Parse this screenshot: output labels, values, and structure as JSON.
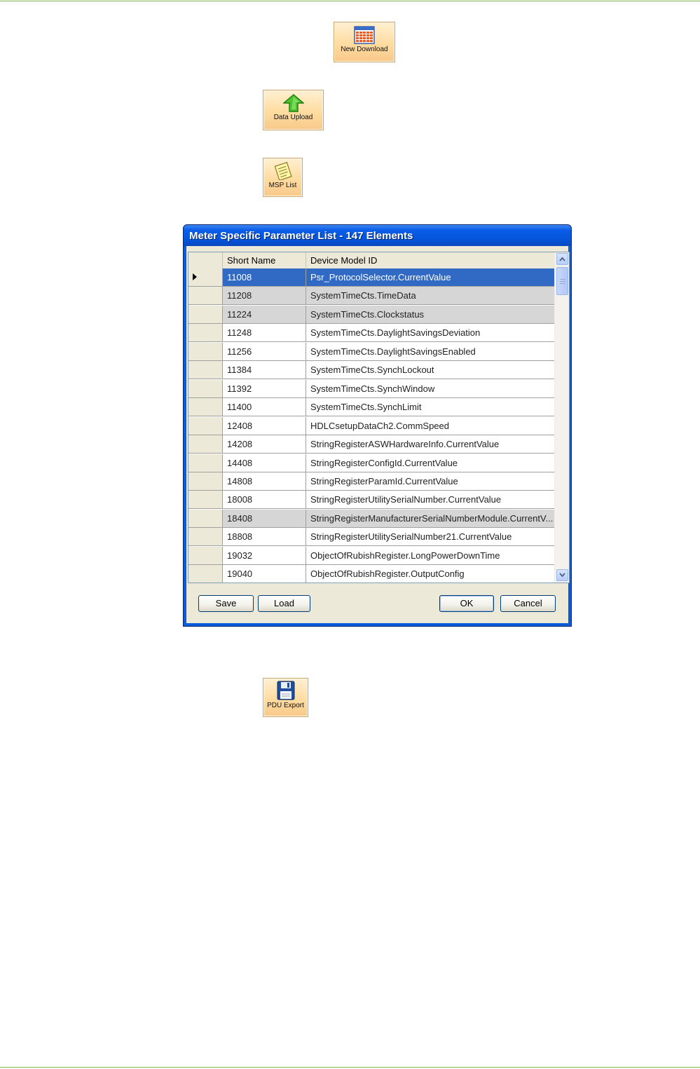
{
  "toolbar": {
    "new_download": "New Download",
    "data_upload": "Data Upload",
    "msp_list": "MSP List",
    "pdu_export": "PDU Export"
  },
  "dialog": {
    "title": "Meter Specific Parameter List - 147 Elements",
    "columns": {
      "short_name": "Short Name",
      "device_model_id": "Device Model ID"
    },
    "rows": [
      {
        "short": "11008",
        "model": "Psr_ProtocolSelector.CurrentValue",
        "state": "selected"
      },
      {
        "short": "11208",
        "model": "SystemTimeCts.TimeData",
        "state": "highlight"
      },
      {
        "short": "11224",
        "model": "SystemTimeCts.Clockstatus",
        "state": "highlight"
      },
      {
        "short": "11248",
        "model": "SystemTimeCts.DaylightSavingsDeviation",
        "state": ""
      },
      {
        "short": "11256",
        "model": "SystemTimeCts.DaylightSavingsEnabled",
        "state": ""
      },
      {
        "short": "11384",
        "model": "SystemTimeCts.SynchLockout",
        "state": ""
      },
      {
        "short": "11392",
        "model": "SystemTimeCts.SynchWindow",
        "state": ""
      },
      {
        "short": "11400",
        "model": "SystemTimeCts.SynchLimit",
        "state": ""
      },
      {
        "short": "12408",
        "model": "HDLCsetupDataCh2.CommSpeed",
        "state": ""
      },
      {
        "short": "14208",
        "model": "StringRegisterASWHardwareInfo.CurrentValue",
        "state": ""
      },
      {
        "short": "14408",
        "model": "StringRegisterConfigId.CurrentValue",
        "state": ""
      },
      {
        "short": "14808",
        "model": "StringRegisterParamId.CurrentValue",
        "state": ""
      },
      {
        "short": "18008",
        "model": "StringRegisterUtilitySerialNumber.CurrentValue",
        "state": ""
      },
      {
        "short": "18408",
        "model": "StringRegisterManufacturerSerialNumberModule.CurrentV...",
        "state": "highlight"
      },
      {
        "short": "18808",
        "model": "StringRegisterUtilitySerialNumber21.CurrentValue",
        "state": ""
      },
      {
        "short": "19032",
        "model": "ObjectOfRubishRegister.LongPowerDownTime",
        "state": ""
      },
      {
        "short": "19040",
        "model": "ObjectOfRubishRegister.OutputConfig",
        "state": ""
      }
    ],
    "buttons": {
      "save": "Save",
      "load": "Load",
      "ok": "OK",
      "cancel": "Cancel"
    }
  },
  "colors": {
    "accent_rule": "#7fb347",
    "selection": "#316ac5",
    "titlebar": "#0a5de8"
  },
  "icons": {
    "new_download": "calendar-grid-icon",
    "data_upload": "green-up-arrow-icon",
    "msp_list": "notepad-icon",
    "pdu_export": "floppy-disk-icon"
  }
}
